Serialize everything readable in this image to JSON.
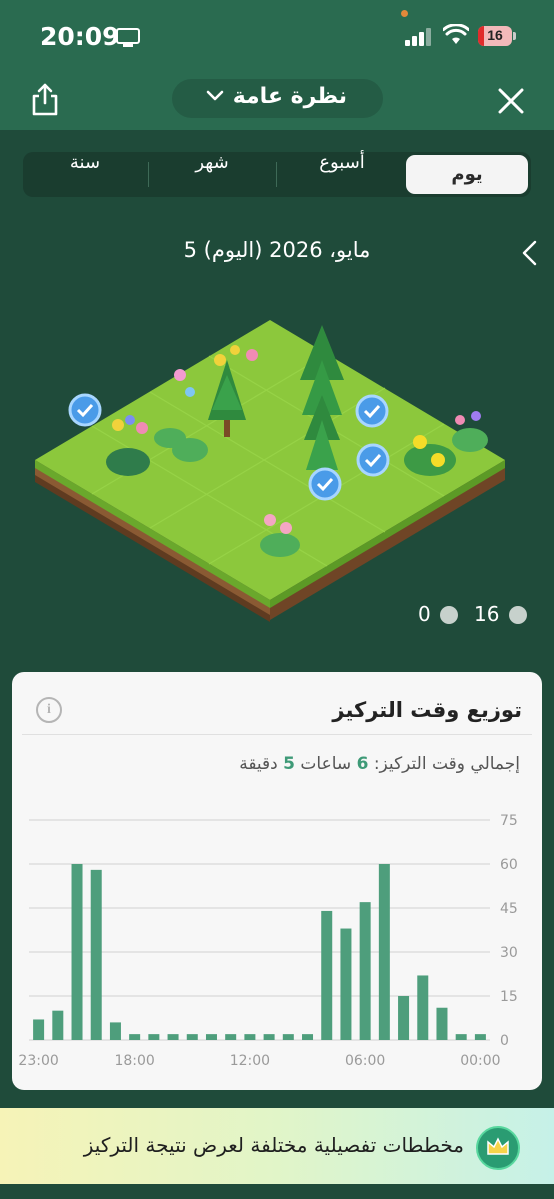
{
  "status_bar": {
    "time": "20:09",
    "battery": "16"
  },
  "header": {
    "title": "نظرة عامة"
  },
  "tabs": [
    {
      "label": "يوم",
      "active": true
    },
    {
      "label": "أسبوع",
      "active": false
    },
    {
      "label": "شهر",
      "active": false
    },
    {
      "label": "سنة",
      "active": false
    }
  ],
  "date_label": "5 مايو، 2026 (اليوم)",
  "counts": {
    "trees": "16",
    "withered": "0"
  },
  "focus_card": {
    "title": "توزيع وقت التركيز",
    "total_prefix": "إجمالي وقت التركيز:",
    "hours": "6",
    "hours_unit": "ساعات",
    "minutes": "5",
    "minutes_unit": "دقيقة"
  },
  "chart_data": {
    "type": "bar",
    "x_ticks": [
      "23:00",
      "18:00",
      "12:00",
      "06:00",
      "00:00"
    ],
    "y_ticks": [
      "75",
      "60",
      "45",
      "30",
      "15",
      "0"
    ],
    "ylim": [
      0,
      75
    ],
    "grid": true,
    "hours": [
      23,
      22,
      21,
      20,
      19,
      18,
      17,
      16,
      15,
      14,
      13,
      12,
      11,
      10,
      9,
      8,
      7,
      6,
      5,
      4,
      3,
      2,
      1,
      0
    ],
    "values": [
      7,
      10,
      60,
      58,
      6,
      2,
      2,
      2,
      2,
      2,
      2,
      2,
      2,
      2,
      2,
      44,
      38,
      47,
      60,
      15,
      22,
      11,
      2,
      2
    ],
    "bar_color": "#4e9e7c"
  },
  "banner": {
    "text": "مخططات تفصيلية مختلفة لعرض نتيجة التركيز"
  },
  "colors": {
    "header": "#2a6b50",
    "background": "#1f4b3a",
    "accent": "#3e9a77"
  }
}
